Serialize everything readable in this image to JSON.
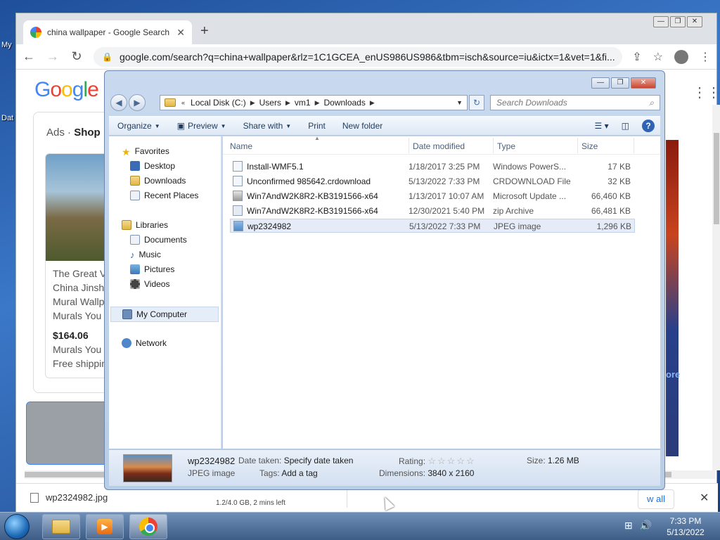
{
  "desktop": {
    "labels": [
      "My",
      "Dat"
    ]
  },
  "chrome": {
    "tab_title": "china wallpaper - Google Search",
    "url": "google.com/search?q=china+wallpaper&rlz=1C1GCEA_enUS986US986&tbm=isch&source=iu&ictx=1&vet=1&fi...",
    "logo": [
      "G",
      "o",
      "o",
      "g",
      "l",
      "e"
    ],
    "ads": {
      "ads_label": "Ads ·",
      "shop_label": "Shop",
      "card": {
        "lines": [
          "The Great V",
          "China Jinsh",
          "Mural Wallp",
          "Murals You"
        ],
        "price": "$164.06",
        "seller": "Murals You",
        "shipping": "Free shippin"
      }
    },
    "see_more": "ore",
    "download_bar": {
      "file_name": "wp2324982.jpg",
      "progress_text": "1.2/4.0 GB, 2 mins left",
      "show_all": "w all"
    }
  },
  "explorer": {
    "breadcrumb": [
      "Local Disk (C:)",
      "Users",
      "vm1",
      "Downloads"
    ],
    "search_placeholder": "Search Downloads",
    "commands": {
      "organize": "Organize",
      "preview": "Preview",
      "share_with": "Share with",
      "print": "Print",
      "new_folder": "New folder"
    },
    "nav": {
      "favorites": "Favorites",
      "desktop": "Desktop",
      "downloads": "Downloads",
      "recent_places": "Recent Places",
      "libraries": "Libraries",
      "documents": "Documents",
      "music": "Music",
      "pictures": "Pictures",
      "videos": "Videos",
      "my_computer": "My Computer",
      "network": "Network"
    },
    "columns": {
      "name": "Name",
      "date_modified": "Date modified",
      "type": "Type",
      "size": "Size"
    },
    "files": [
      {
        "name": "Install-WMF5.1",
        "date": "1/18/2017 3:25 PM",
        "type": "Windows PowerS...",
        "size": "17 KB",
        "icon": "script-icon"
      },
      {
        "name": "Unconfirmed 985642.crdownload",
        "date": "5/13/2022 7:33 PM",
        "type": "CRDOWNLOAD File",
        "size": "32 KB",
        "icon": "file-icon"
      },
      {
        "name": "Win7AndW2K8R2-KB3191566-x64",
        "date": "1/13/2017 10:07 AM",
        "type": "Microsoft Update ...",
        "size": "66,460 KB",
        "icon": "update-icon"
      },
      {
        "name": "Win7AndW2K8R2-KB3191566-x64",
        "date": "12/30/2021 5:40 PM",
        "type": "zip Archive",
        "size": "66,481 KB",
        "icon": "zip-icon"
      },
      {
        "name": "wp2324982",
        "date": "5/13/2022 7:33 PM",
        "type": "JPEG image",
        "size": "1,296 KB",
        "icon": "jpeg-icon"
      }
    ],
    "details": {
      "file_name": "wp2324982",
      "file_type": "JPEG image",
      "date_taken_label": "Date taken:",
      "date_taken_value": "Specify date taken",
      "tags_label": "Tags:",
      "tags_value": "Add a tag",
      "rating_label": "Rating:",
      "rating_stars": "☆☆☆☆☆",
      "dimensions_label": "Dimensions:",
      "dimensions_value": "3840 x 2160",
      "size_label": "Size:",
      "size_value": "1.26 MB"
    }
  },
  "taskbar": {
    "time": "7:33 PM",
    "date": "5/13/2022"
  }
}
